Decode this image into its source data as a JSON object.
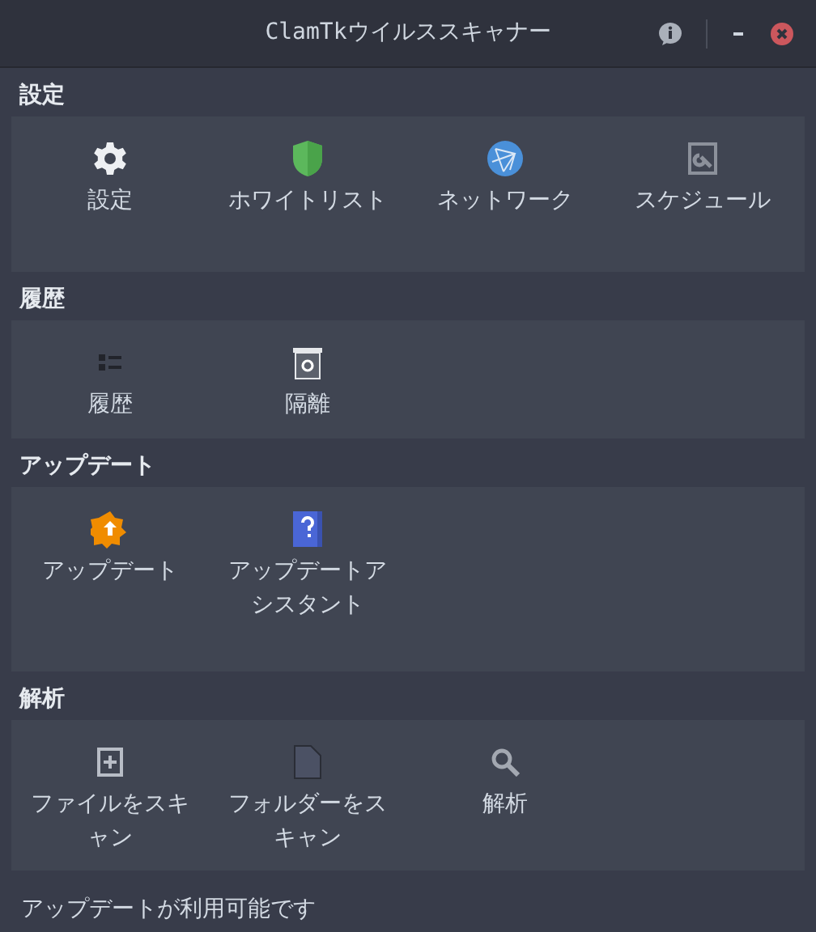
{
  "window": {
    "title": "ClamTkウイルススキャナー"
  },
  "sections": [
    {
      "heading": "設定",
      "items": [
        {
          "label": "設定"
        },
        {
          "label": "ホワイトリスト"
        },
        {
          "label": "ネットワーク"
        },
        {
          "label": "スケジュール"
        }
      ]
    },
    {
      "heading": "履歴",
      "items": [
        {
          "label": "履歴"
        },
        {
          "label": "隔離"
        }
      ]
    },
    {
      "heading": "アップデート",
      "items": [
        {
          "label": "アップデート"
        },
        {
          "label": "アップデートアシスタント"
        }
      ]
    },
    {
      "heading": "解析",
      "items": [
        {
          "label": "ファイルをスキャン"
        },
        {
          "label": "フォルダーをスキャン"
        },
        {
          "label": "解析"
        }
      ]
    }
  ],
  "status_bar": "アップデートが利用可能です"
}
